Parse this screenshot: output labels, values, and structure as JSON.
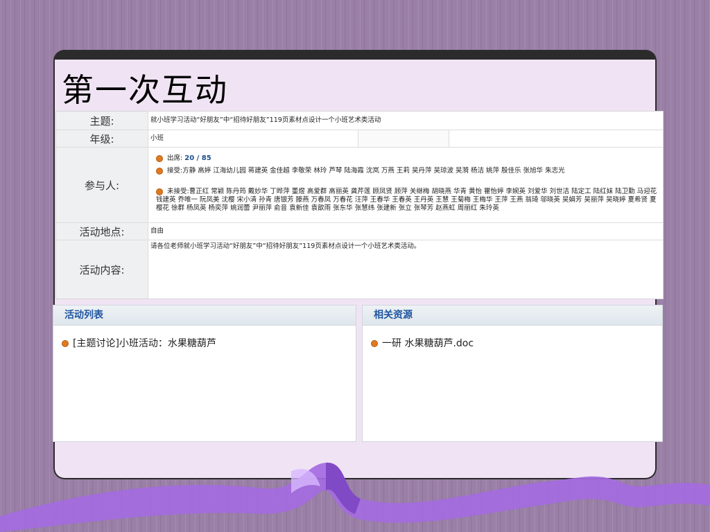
{
  "slide": {
    "title": "第一次互动"
  },
  "info_table": {
    "topic": {
      "label": "主题:",
      "value": "就小班学习活动“好朋友”中“招待好朋友”119页素材点设计一个小班艺术类活动"
    },
    "grade": {
      "label": "年级:",
      "value": "小班"
    },
    "participants": {
      "label": "参与人:",
      "attendance_label": "出席:",
      "attendance_value": "20 / 85",
      "accepted_label": "接受:",
      "accepted_names": "方静 高婷 江海幼儿园 蒋建英 金佳超 李敬荣 林玲 芦琴 陆海霞 沈岚 万燕 王莉 吴丹萍 吴琼波 吴漪 杨洁 姚萍 殷佳乐 张旭华 朱志光",
      "not_accepted_label": "未接受:",
      "not_accepted_names": "曹正红 常颖 陈丹筠 戴妙华 丁晔萍 董煜 高爱群 高丽英 龚芹莲 顾凤贤 顾萍 关继梅 胡晓燕 华青 黄怡 瞿怡婷 李婉英 刘爱华 刘世洁 陆定工 陆红妹 陆卫勤 马迎花 钱建英 乔唯一 阮凤美 沈樱 宋小清 孙青 唐银芳 滕燕 万春凤 万春花 汪萍 王春华 王春英 王丹英 王慧 王菊梅 王梅华 王萍 王燕 翁琦 邬晓英 吴娟芳 吴丽萍 吴晓婷 夏希贤 夏樱花 徐群 杨凤英 杨奕萍 姚润蕾 尹丽萍 俞音 袁新佳 袁歆雨 张东华 张慧纬 张建新 张立 张琴芳 赵燕虹 周丽红 朱玲英"
    },
    "location": {
      "label": "活动地点:",
      "value": "自由"
    },
    "content": {
      "label": "活动内容:",
      "value": "请各位老师就小班学习活动“好朋友”中“招待好朋友”119页素材点设计一个小班艺术类活动。"
    }
  },
  "activity_list": {
    "title": "活动列表",
    "items": [
      "[主题讨论]小班活动：水果糖葫芦"
    ]
  },
  "resources": {
    "title": "相关资源",
    "items": [
      "一研 水果糖葫芦.doc"
    ]
  },
  "colors": {
    "accent_blue": "#1f56a0",
    "bullet_orange": "#e07a1f",
    "slide_bg": "#f0e4f4",
    "ribbon": "#a46be0"
  }
}
